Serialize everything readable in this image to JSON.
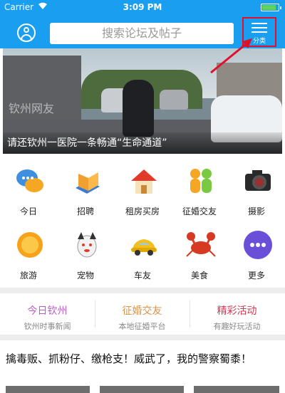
{
  "status_bar": {
    "carrier": "Carrier",
    "time": "3:09 PM",
    "battery_level": 0.85
  },
  "header": {
    "search_placeholder": "搜索论坛及帖子",
    "category_label": "分类"
  },
  "banner": {
    "caption": "请还钦州一医院一条畅通“生命通道”",
    "watermark": "钦州网友"
  },
  "grid": {
    "items": [
      {
        "label": "今日",
        "icon": "chat-bubbles-icon"
      },
      {
        "label": "招聘",
        "icon": "books-icon"
      },
      {
        "label": "租房买房",
        "icon": "house-icon"
      },
      {
        "label": "征婚交友",
        "icon": "couple-icon"
      },
      {
        "label": "摄影",
        "icon": "camera-icon"
      },
      {
        "label": "旅游",
        "icon": "sun-icon"
      },
      {
        "label": "宠物",
        "icon": "dog-icon"
      },
      {
        "label": "车友",
        "icon": "car-icon"
      },
      {
        "label": "美食",
        "icon": "crab-icon"
      },
      {
        "label": "更多",
        "icon": "more-dots-icon"
      }
    ]
  },
  "sections": [
    {
      "title": "今日钦州",
      "subtitle": "钦州时事新闻",
      "color": "#b95fc4"
    },
    {
      "title": "征婚交友",
      "subtitle": "本地征婚平台",
      "color": "#d9934a"
    },
    {
      "title": "精彩活动",
      "subtitle": "有趣好玩活动",
      "color": "#d03a52"
    }
  ],
  "headline": "擒毒贩、抓粉仔、缴枪支！威武了，我的警察蜀黍！",
  "colors": {
    "brand": "#1a9ff0",
    "highlight": "#e0102a"
  }
}
